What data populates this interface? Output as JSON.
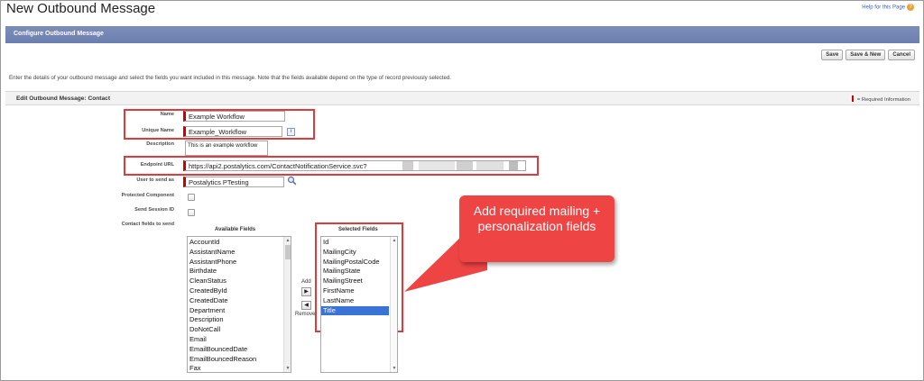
{
  "page": {
    "title": "New Outbound Message",
    "help_link": "Help for this Page",
    "help_icon": "help-icon"
  },
  "banner": {
    "title": "Configure Outbound Message"
  },
  "toolbar": {
    "save": "Save",
    "save_new": "Save & New",
    "cancel": "Cancel"
  },
  "intro": "Enter the details of your outbound message and select the fields you want included in this message. Note that the fields available depend on the type of record previously selected.",
  "section": {
    "title": "Edit Outbound Message: Contact",
    "required_note": "= Required Information",
    "required_color": "#cc0000"
  },
  "form": {
    "name_label": "Name",
    "name_value": "Example Workflow",
    "unique_name_label": "Unique Name",
    "unique_name_value": "Example_Workflow",
    "info_icon": "i",
    "description_label": "Description",
    "description_value": "This is an example workflow",
    "endpoint_label": "Endpoint URL",
    "endpoint_value": "https://api2.postalytics.com/ContactNotificationService.svc?",
    "user_label": "User to send as",
    "user_value": "Postalytics PTesting",
    "protected_label": "Protected Component",
    "session_label": "Send Session ID",
    "contact_fields_label": "Contact fields to send"
  },
  "fields": {
    "available_caption": "Available Fields",
    "selected_caption": "Selected Fields",
    "available": [
      "AccountId",
      "AssistantName",
      "AssistantPhone",
      "Birthdate",
      "CleanStatus",
      "CreatedById",
      "CreatedDate",
      "Department",
      "Description",
      "DoNotCall",
      "Email",
      "EmailBouncedDate",
      "EmailBouncedReason",
      "Fax"
    ],
    "selected": [
      "Id",
      "MailingCity",
      "MailingPostalCode",
      "MailingState",
      "MailingStreet",
      "FirstName",
      "LastName",
      "Title"
    ],
    "selected_highlight": "Title",
    "add_label": "Add",
    "remove_label": "Remove",
    "add_arrow": "▶",
    "remove_arrow": "◀"
  },
  "annotation": {
    "callout_text": "Add required mailing + personalization fields",
    "callout_color": "#ef4444",
    "box_color": "#e23a3a"
  }
}
